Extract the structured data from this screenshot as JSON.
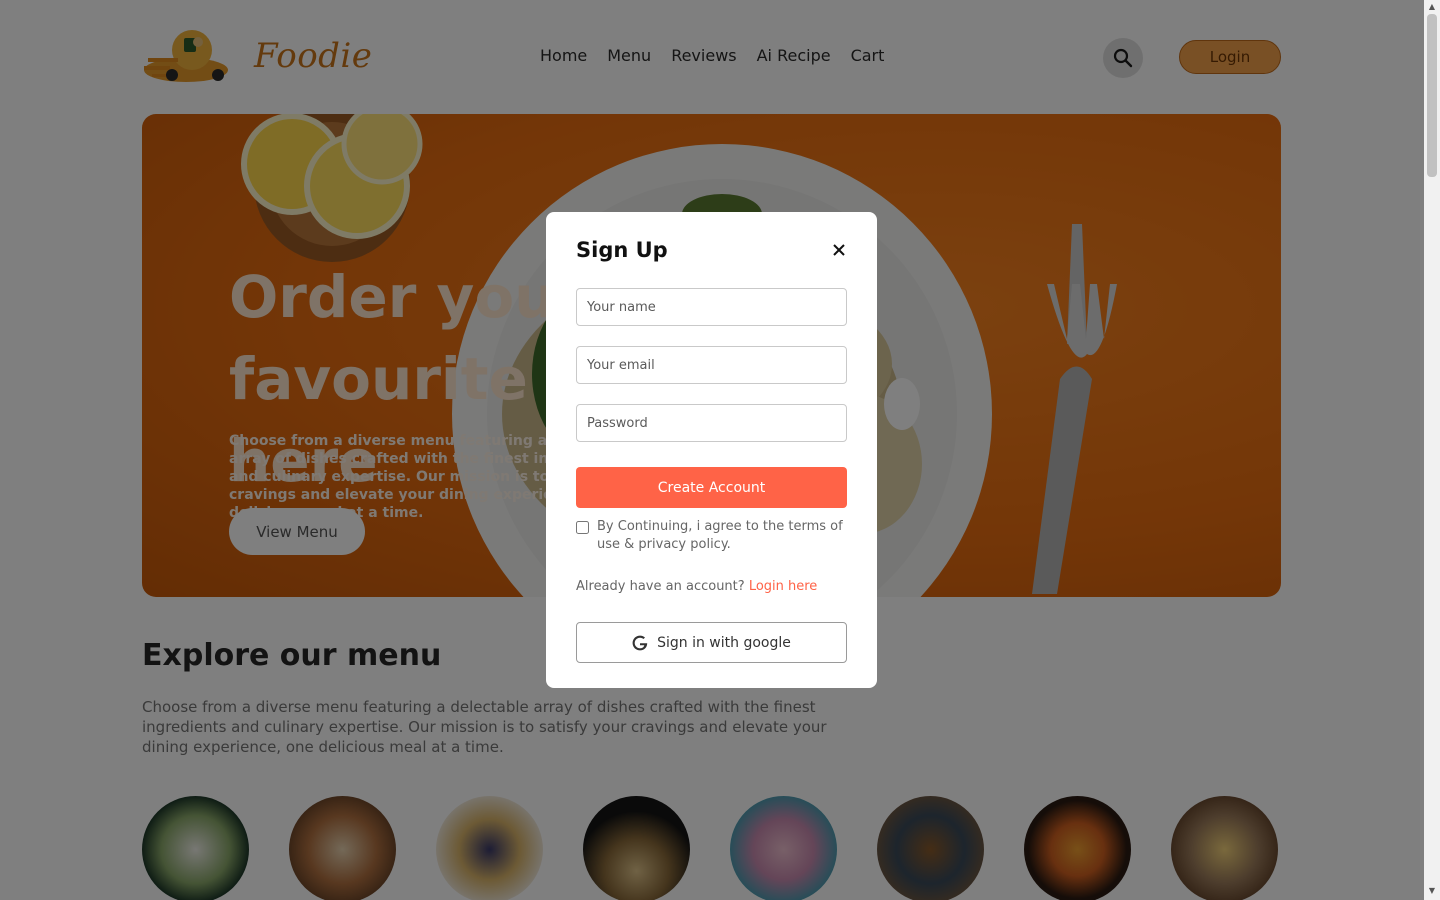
{
  "brand": {
    "name": "Foodie",
    "logo_icon": "delivery-scooter-logo"
  },
  "nav": {
    "items": [
      {
        "label": "Home"
      },
      {
        "label": "Menu"
      },
      {
        "label": "Reviews"
      },
      {
        "label": "Ai Recipe"
      },
      {
        "label": "Cart"
      }
    ],
    "search_icon": "search-icon",
    "login_label": "Login"
  },
  "hero": {
    "title": "Order your favourite food here",
    "description": "Choose from a diverse menu featuring a delectable array of dishes crafted with the finest ingredients and culinary expertise. Our mission is to satisfy your cravings and elevate your dining experience, one delicious meal at a time.",
    "button_label": "View Menu"
  },
  "explore": {
    "title": "Explore our menu",
    "description": "Choose from a diverse menu featuring a delectable array of dishes crafted with the finest ingredients and culinary expertise. Our mission is to satisfy your cravings and elevate your dining experience, one delicious meal at a time."
  },
  "menu_images": [
    {
      "icon": "salad-bowl-image",
      "color": "#3f7a3a"
    },
    {
      "icon": "wrap-image",
      "color": "#a86a3a"
    },
    {
      "icon": "waffle-image",
      "color": "#d9b46a"
    },
    {
      "icon": "sandwich-image",
      "color": "#222222"
    },
    {
      "icon": "cake-image",
      "color": "#c98bb0"
    },
    {
      "icon": "rice-bowl-image",
      "color": "#3a4a5a"
    },
    {
      "icon": "pasta-image",
      "color": "#4a2b1a"
    },
    {
      "icon": "ramen-image",
      "color": "#6a5a4a"
    }
  ],
  "modal": {
    "title": "Sign Up",
    "close_icon": "close-icon",
    "name_placeholder": "Your name",
    "email_placeholder": "Your email",
    "password_placeholder": "Password",
    "create_label": "Create Account",
    "terms_text": "By Continuing, i agree to the terms of use & privacy policy.",
    "login_prompt": "Already have an account?",
    "login_link": "Login here",
    "google_label": "Sign in with google",
    "google_icon": "google-icon"
  },
  "colors": {
    "accent": "#ff6347",
    "brand": "#c8751b",
    "hero_bg": "#e86d10",
    "login_btn": "#f3a14a"
  }
}
